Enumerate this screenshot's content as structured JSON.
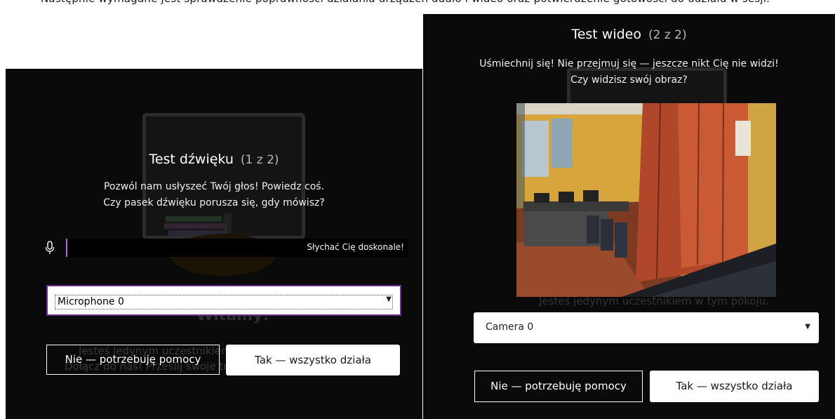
{
  "caption": {
    "text": "Następnie wymagane jest sprawdzenie poprawności działania urządzeń audio i wideo oraz potwierdzenie gotowości do udziału w sesji."
  },
  "sound_test": {
    "title": "Test dźwięku",
    "step": "(1 z 2)",
    "line1": "Pozwól nam usłyszeć Twój głos! Powiedz coś.",
    "line2": "Czy pasek dźwięku porusza się, gdy mówisz?",
    "mic_status": "Słychać Cię doskonale!",
    "mic_level": 0.004,
    "selected_microphone": "Microphone 0",
    "no_button": "Nie — potrzebuję pomocy",
    "yes_button": "Tak — wszystko działa",
    "bg_welcome": "Witamy!",
    "bg_line1": "Jesteś jedynym uczestnikiem w tym pokoju.",
    "bg_line2": "Dołącz do nas! Prześlij swoje treści."
  },
  "video_test": {
    "title": "Test wideo",
    "step": "(2 z 2)",
    "line1": "Uśmiechnij się! Nie przejmuj się — jeszcze nikt Cię nie widzi!",
    "line2": "Czy widzisz swój obraz?",
    "selected_camera": "Camera 0",
    "no_button": "Nie — potrzebuję pomocy",
    "yes_button": "Tak — wszystko działa",
    "bg_line1": "Jesteś jedynym uczestnikiem w tym pokoju."
  },
  "colors": {
    "panel_bg": "#0a0a0a",
    "accent_purple": "#6a2c8c",
    "level_purple": "#b06ad9"
  }
}
